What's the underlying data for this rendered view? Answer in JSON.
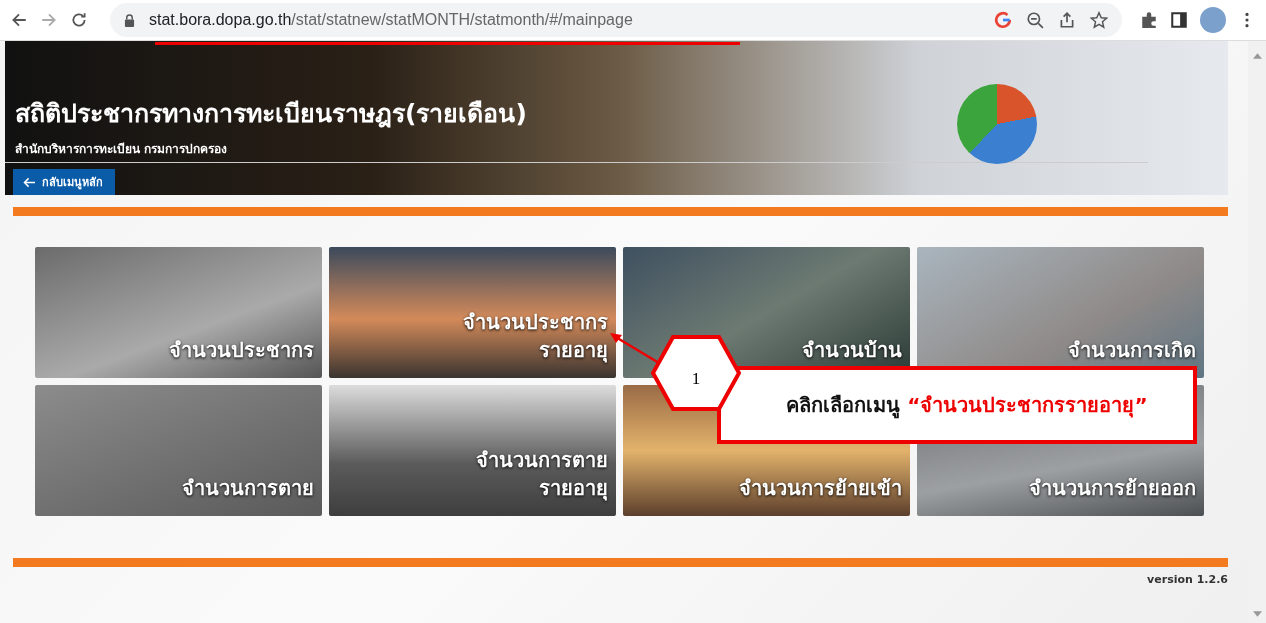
{
  "browser": {
    "url_host": "stat.bora.dopa.go.th",
    "url_path": "/stat/statnew/statMONTH/statmonth/#/mainpage"
  },
  "header": {
    "title": "สถิติประชากรทางการทะเบียนราษฎร(รายเดือน)",
    "subtitle": "สำนักบริหารการทะเบียน กรมการปกครอง",
    "back_button": "กลับเมนูหลัก"
  },
  "tiles": [
    {
      "lines": [
        "จำนวนประชากร"
      ]
    },
    {
      "lines": [
        "จำนวนประชากร",
        "รายอายุ"
      ]
    },
    {
      "lines": [
        "จำนวนบ้าน"
      ]
    },
    {
      "lines": [
        "จำนวนการเกิด"
      ]
    },
    {
      "lines": [
        "จำนวนการตาย"
      ]
    },
    {
      "lines": [
        "จำนวนการตาย",
        "รายอายุ"
      ]
    },
    {
      "lines": [
        "จำนวนการย้ายเข้า"
      ]
    },
    {
      "lines": [
        "จำนวนการย้ายออก"
      ]
    }
  ],
  "annotation": {
    "step": "1",
    "text": "คลิกเลือกเมนู",
    "highlight": "“จำนวนประชากรรายอายุ”"
  },
  "footer": {
    "version": "version 1.2.6"
  }
}
